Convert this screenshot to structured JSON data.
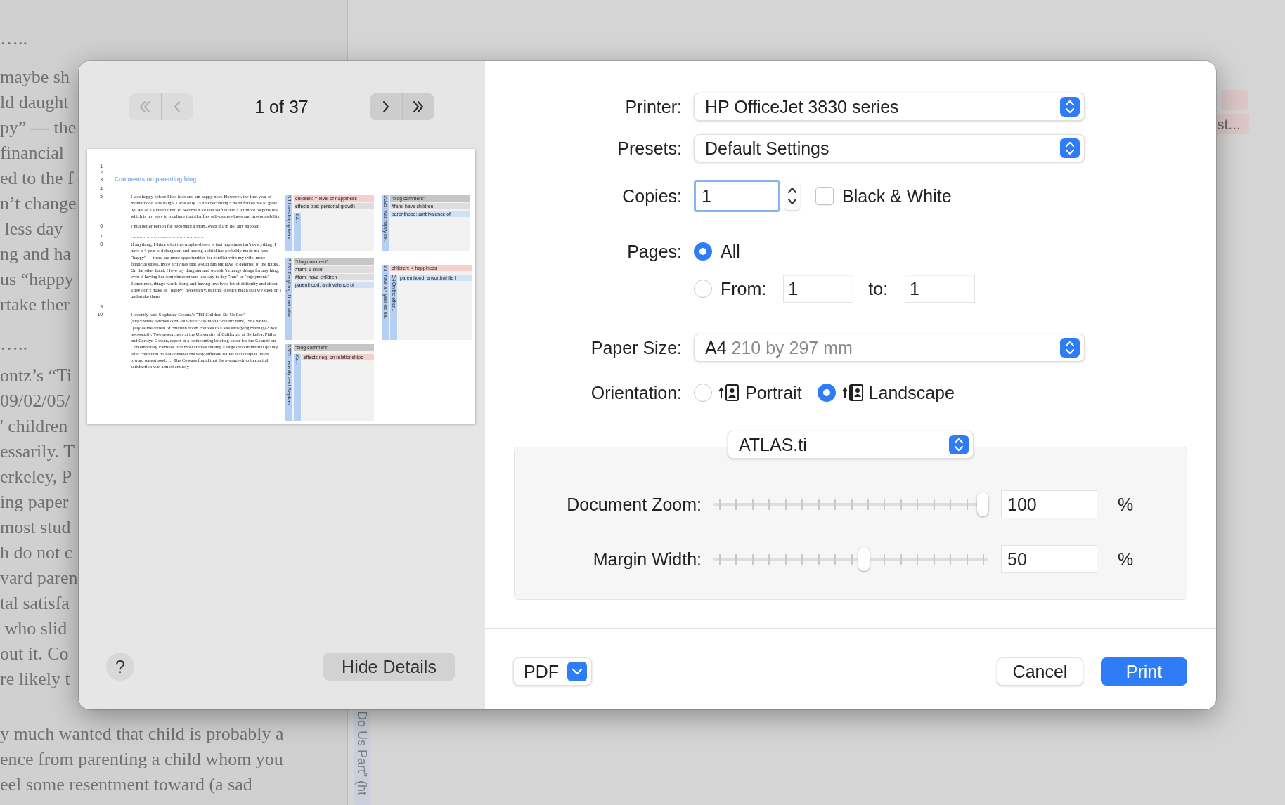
{
  "background": {
    "lines": [
      {
        "kind": "separator",
        "text": "….."
      },
      {
        "kind": "text",
        "text": "maybe sh"
      },
      {
        "kind": "text",
        "text": "ld daught"
      },
      {
        "kind": "text",
        "text": "py” — the"
      },
      {
        "kind": "text",
        "text": "financial"
      },
      {
        "kind": "text",
        "text": "ed to the f"
      },
      {
        "kind": "text",
        "text": "n’t change"
      },
      {
        "kind": "text",
        "text": " less day"
      },
      {
        "kind": "text",
        "text": "ng and ha"
      },
      {
        "kind": "text",
        "text": "us “happy"
      },
      {
        "kind": "text",
        "text": "rtake ther"
      },
      {
        "kind": "separator",
        "text": "….."
      },
      {
        "kind": "text",
        "text": "ontz’s “Ti"
      },
      {
        "kind": "text",
        "text": "09/02/05/"
      },
      {
        "kind": "text",
        "text": "' children"
      },
      {
        "kind": "text",
        "text": "essarily. T"
      },
      {
        "kind": "text",
        "text": "erkeley, P"
      },
      {
        "kind": "text",
        "text": "ing paper"
      },
      {
        "kind": "text",
        "text": "most stud"
      },
      {
        "kind": "text",
        "text": "h do not c"
      },
      {
        "kind": "text",
        "text": "vard paren"
      },
      {
        "kind": "text",
        "text": "tal satisfa"
      },
      {
        "kind": "text",
        "text": " who slid"
      },
      {
        "kind": "text",
        "text": "out it. Co"
      },
      {
        "kind": "text",
        "text": "re likely t"
      }
    ],
    "lower_lines": [
      "y much wanted that child is probably a",
      "ence from parenting a child whom you",
      "eel some resentment toward (a sad"
    ],
    "vertical_label": "Do Us Part” (ht",
    "tag": "st..."
  },
  "dialog": {
    "preview": {
      "nav": [
        {
          "kind": "first",
          "disabled": true
        },
        {
          "kind": "prev",
          "disabled": true
        },
        {
          "kind": "next",
          "disabled": false
        },
        {
          "kind": "last",
          "disabled": false
        }
      ],
      "page_indicator": "1 of 37",
      "page": {
        "rows": [
          {
            "number": "1",
            "kind": "blank"
          },
          {
            "number": "2",
            "kind": "blank"
          },
          {
            "number": "3",
            "kind": "heading",
            "text": "Comments on parenting blog"
          },
          {
            "number": "4",
            "kind": "dots",
            "text": "……………………………………………"
          },
          {
            "number": "5",
            "kind": "text",
            "text": "I was happy before I had kids and am happy now. However, the first year of motherhood was rough. I was only 25 and becoming a mom forced me to grow up. All of a sudden I had to become a lot less selfish and a lot more responsible, which is not easy in a culture that glorifies self-centeredness and irresponsibility."
          },
          {
            "number": "6",
            "kind": "text",
            "text": "I’m a better person for becoming a mom, even if I’m not any happier."
          },
          {
            "number": "7",
            "kind": "dots",
            "text": "……………………………………………"
          },
          {
            "number": "8",
            "kind": "text",
            "text": "If anything, I think what this maybe shows is that happiness isn’t everything. I have a 4-year-old daughter, and having a child has probably made me less “happy” — there are more opportunities for conflict with my wife, more financial stress, more activities that would fun but have to deferred to the future. On the other hand, I love my daughter and wouldn’t change things for anything, even if having her sometimes means less day to day “fun” or “enjoyment.” Sometimes, things worth doing and having involve a lot of difficulty and effort. They don’t make us “happy” necessarily, but that doesn’t mean that we shouldn’t undertake them."
          },
          {
            "number": "9",
            "kind": "dots",
            "text": "……………………………………………"
          },
          {
            "number": "10",
            "kind": "text",
            "text": "I recently read Stephanie Coontz’s “Till Children Do Us Part” (http://www.nytimes.com/2009/02/05/opinion/05coontz.html). She writes, “[D]oes the arrival of children doom couples to a less satisfying marriage? Not necessarily. Two researchers at the University of California at Berkeley, Philip and Carolyn Cowan, report in a forthcoming briefing paper for the Council on Contemporary Families that most studies finding a large drop in marital quality after childbirth do not consider the very different routes that couples travel toward parenthood. … The Cowans found that the average drop in marital satisfaction was almost entirely"
          }
        ],
        "codes": [
          {
            "label": "3:1 I was happy befor...",
            "tags": [
              {
                "text": "children: = level of happiness",
                "color": "#f4cfcc"
              },
              {
                "text": "effects pos: personal growth",
                "color": "#dddddd"
              }
            ],
            "sub": {
              "label": "3:2..."
            }
          },
          {
            "label": "3:235 I was happy be...",
            "tags": [
              {
                "text": "“blog comment”",
                "color": "#c6c6c6"
              },
              {
                "text": "#fam: have children",
                "color": "#dddddd"
              },
              {
                "text": "parenthood: ambivalence of",
                "color": "#cfe0f7"
              }
            ]
          },
          {
            "label": "3:236 If anything, I think wha...",
            "tags": [
              {
                "text": "“blog comment”",
                "color": "#c6c6c6"
              },
              {
                "text": "#fam: 1 child",
                "color": "#dddddd"
              },
              {
                "text": "#fam: have children",
                "color": "#dddddd"
              },
              {
                "text": "parenthood: ambivalence of",
                "color": "#cfe0f7"
              }
            ]
          },
          {
            "label": "3:3 I have a 4-year-old da...",
            "tags": [
              {
                "text": "children: < happiness",
                "color": "#f4cfcc"
              }
            ],
            "sub": {
              "label": "3:4 On the other...",
              "tags": [
                {
                  "text": "parenthood: a worthwhile t",
                  "color": "#cfe0f7"
                }
              ]
            }
          },
          {
            "label": "3:305 I recently read Stephan...",
            "tags": [
              {
                "text": "“blog comment”",
                "color": "#c6c6c6"
              }
            ],
            "sub": {
              "label": "3:3...",
              "tags": [
                {
                  "text": "effects neg: on relationships",
                  "color": "#f4cfcc"
                }
              ]
            }
          }
        ]
      }
    },
    "help_button": "?",
    "hide_details_button": "Hide Details",
    "printer": {
      "label": "Printer:",
      "value": "HP OfficeJet 3830 series"
    },
    "presets": {
      "label": "Presets:",
      "value": "Default Settings"
    },
    "copies": {
      "label": "Copies:",
      "value": "1",
      "focused": true,
      "black_white": {
        "label": "Black & White",
        "checked": false
      }
    },
    "pages": {
      "label": "Pages:",
      "options": [
        {
          "label": "All",
          "selected": true
        },
        {
          "label": "From:",
          "selected": false
        }
      ],
      "from": "1",
      "to_label": "to:",
      "to": "1"
    },
    "paper_size": {
      "label": "Paper Size:",
      "value": "A4",
      "detail": "210 by 297 mm"
    },
    "orientation": {
      "label": "Orientation:",
      "options": [
        {
          "kind": "portrait",
          "label": "Portrait",
          "selected": false
        },
        {
          "kind": "landscape",
          "label": "Landscape",
          "selected": true
        }
      ]
    },
    "section_popup": "ATLAS.ti",
    "sliders": [
      {
        "label": "Document Zoom:",
        "level": 1.0,
        "value": "100",
        "unit": "%"
      },
      {
        "label": "Margin Width:",
        "level": 0.55,
        "value": "50",
        "unit": "%"
      }
    ],
    "pdf_button": "PDF",
    "cancel_button": "Cancel",
    "print_button": "Print"
  }
}
